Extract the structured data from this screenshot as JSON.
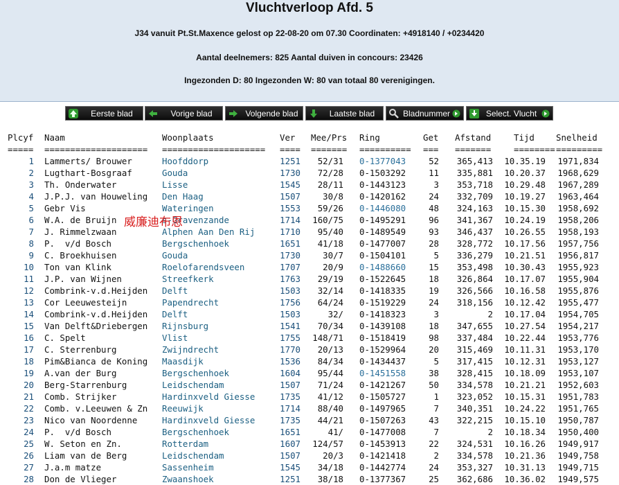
{
  "header": {
    "title": "Vluchtverloop Afd. 5",
    "line1": "J34 vanuit Pt.St.Maxence gelost op 22-08-20 om 07.30 Coordinaten: +4918140 / +0234420",
    "line2": "Aantal deelnemers: 825 Aantal duiven in concours: 23426",
    "line3": "Ingezonden D: 80 Ingezonden W: 80 van totaal 80 verenigingen."
  },
  "nav": {
    "first": "Eerste blad",
    "prev": "Vorige blad",
    "next": "Volgende blad",
    "last": "Laatste blad",
    "page": "Bladnummer",
    "select": "Select. Vlucht"
  },
  "columns": {
    "plcyf": "Plcyf",
    "naam": "Naam",
    "woonplaats": "Woonplaats",
    "ver": "Ver",
    "meeprs": "Mee/Prs",
    "ring": "Ring",
    "get": "Get",
    "afstand": "Afstand",
    "tijd": "Tijd",
    "snelheid": "Snelheid"
  },
  "underline": {
    "plcyf": "=====",
    "naam": "====================",
    "woonplaats": "====================",
    "ver": "====",
    "meeprs": "=======",
    "ring": "==========",
    "get": "===",
    "afstand": "=======",
    "tijd": "========",
    "snelheid": "========="
  },
  "rows": [
    {
      "p": "1",
      "n": "Lammerts/ Brouwer",
      "w": "Hoofddorp",
      "v": "1251",
      "m": "52/31",
      "r": "0-1377043",
      "g": "52",
      "a": "365,413",
      "t": "10.35.19",
      "s": "1971,834"
    },
    {
      "p": "2",
      "n": "Lugthart-Bosgraaf",
      "w": "Gouda",
      "v": "1730",
      "m": "72/28",
      "r": "0-1503292",
      "g": "11",
      "a": "335,881",
      "t": "10.20.37",
      "s": "1968,629"
    },
    {
      "p": "3",
      "n": "Th. Onderwater",
      "w": "Lisse",
      "v": "1545",
      "m": "28/11",
      "r": "0-1443123",
      "g": "3",
      "a": "353,718",
      "t": "10.29.48",
      "s": "1967,289"
    },
    {
      "p": "4",
      "n": "J.P.J. van Houweling",
      "w": "Den Haag",
      "v": "1507",
      "m": "30/8",
      "r": "0-1420162",
      "g": "24",
      "a": "332,709",
      "t": "10.19.27",
      "s": "1963,464"
    },
    {
      "p": "5",
      "n": "Gebr Vis",
      "w": "Wateringen",
      "v": "1553",
      "m": "59/26",
      "r": "0-1446080",
      "g": "48",
      "a": "324,163",
      "t": "10.15.30",
      "s": "1958,692"
    },
    {
      "p": "6",
      "n": "W.A. de Bruijn",
      "w": "s-Gravenzande",
      "v": "1714",
      "m": "160/75",
      "r": "0-1495291",
      "g": "96",
      "a": "341,367",
      "t": "10.24.19",
      "s": "1958,206"
    },
    {
      "p": "7",
      "n": "J. Rimmelzwaan",
      "w": "Alphen Aan Den Rij",
      "v": "1710",
      "m": "95/40",
      "r": "0-1489549",
      "g": "93",
      "a": "346,437",
      "t": "10.26.55",
      "s": "1958,193"
    },
    {
      "p": "8",
      "n": "P.  v/d Bosch",
      "w": "Bergschenhoek",
      "v": "1651",
      "m": "41/18",
      "r": "0-1477007",
      "g": "28",
      "a": "328,772",
      "t": "10.17.56",
      "s": "1957,756"
    },
    {
      "p": "9",
      "n": "C. Broekhuisen",
      "w": "Gouda",
      "v": "1730",
      "m": "30/7",
      "r": "0-1504101",
      "g": "5",
      "a": "336,279",
      "t": "10.21.51",
      "s": "1956,817"
    },
    {
      "p": "10",
      "n": "Ton van Klink",
      "w": "Roelofarendsveen",
      "v": "1707",
      "m": "20/9",
      "r": "0-1488660",
      "g": "15",
      "a": "353,498",
      "t": "10.30.43",
      "s": "1955,923"
    },
    {
      "p": "11",
      "n": "J.P. van Wijnen",
      "w": "Streefkerk",
      "v": "1763",
      "m": "29/19",
      "r": "0-1522645",
      "g": "18",
      "a": "326,864",
      "t": "10.17.07",
      "s": "1955,904"
    },
    {
      "p": "12",
      "n": "Combrink-v.d.Heijden",
      "w": "Delft",
      "v": "1503",
      "m": "32/14",
      "r": "0-1418335",
      "g": "19",
      "a": "326,566",
      "t": "10.16.58",
      "s": "1955,876"
    },
    {
      "p": "13",
      "n": "Cor Leeuwesteijn",
      "w": "Papendrecht",
      "v": "1756",
      "m": "64/24",
      "r": "0-1519229",
      "g": "24",
      "a": "318,156",
      "t": "10.12.42",
      "s": "1955,477"
    },
    {
      "p": "14",
      "n": "Combrink-v.d.Heijden",
      "w": "Delft",
      "v": "1503",
      "m": "32/",
      "r": "0-1418323",
      "g": "3",
      "a": "2",
      "t": "10.17.04",
      "s": "1954,705"
    },
    {
      "p": "15",
      "n": "Van Delft&Driebergen",
      "w": "Rijnsburg",
      "v": "1541",
      "m": "70/34",
      "r": "0-1439108",
      "g": "18",
      "a": "347,655",
      "t": "10.27.54",
      "s": "1954,217"
    },
    {
      "p": "16",
      "n": "C. Spelt",
      "w": "Vlist",
      "v": "1755",
      "m": "148/71",
      "r": "0-1518419",
      "g": "98",
      "a": "337,484",
      "t": "10.22.44",
      "s": "1953,776"
    },
    {
      "p": "17",
      "n": "C. Sterrenburg",
      "w": "Zwijndrecht",
      "v": "1770",
      "m": "20/13",
      "r": "0-1529964",
      "g": "20",
      "a": "315,469",
      "t": "10.11.31",
      "s": "1953,170"
    },
    {
      "p": "18",
      "n": "Pim&Bianca de Koning",
      "w": "Maasdijk",
      "v": "1536",
      "m": "84/34",
      "r": "0-1434437",
      "g": "5",
      "a": "317,415",
      "t": "10.12.31",
      "s": "1953,127"
    },
    {
      "p": "19",
      "n": "A.van der Burg",
      "w": "Bergschenhoek",
      "v": "1604",
      "m": "95/44",
      "r": "0-1451558",
      "g": "38",
      "a": "328,415",
      "t": "10.18.09",
      "s": "1953,107"
    },
    {
      "p": "20",
      "n": "Berg-Starrenburg",
      "w": "Leidschendam",
      "v": "1507",
      "m": "71/24",
      "r": "0-1421267",
      "g": "50",
      "a": "334,578",
      "t": "10.21.21",
      "s": "1952,603"
    },
    {
      "p": "21",
      "n": "Comb. Strijker",
      "w": "Hardinxveld Giesse",
      "v": "1735",
      "m": "41/12",
      "r": "0-1505727",
      "g": "1",
      "a": "323,052",
      "t": "10.15.31",
      "s": "1951,783"
    },
    {
      "p": "22",
      "n": "Comb. v.Leeuwen & Zn",
      "w": "Reeuwijk",
      "v": "1714",
      "m": "88/40",
      "r": "0-1497965",
      "g": "7",
      "a": "340,351",
      "t": "10.24.22",
      "s": "1951,765"
    },
    {
      "p": "23",
      "n": "Nico van Noordenne",
      "w": "Hardinxveld Giesse",
      "v": "1735",
      "m": "44/21",
      "r": "0-1507263",
      "g": "43",
      "a": "322,215",
      "t": "10.15.10",
      "s": "1950,787"
    },
    {
      "p": "24",
      "n": "P.  v/d Bosch",
      "w": "Bergschenhoek",
      "v": "1651",
      "m": "41/",
      "r": "0-1477008",
      "g": "7",
      "a": "2",
      "t": "10.18.34",
      "s": "1950,400"
    },
    {
      "p": "25",
      "n": "W. Seton en Zn.",
      "w": "Rotterdam",
      "v": "1607",
      "m": "124/57",
      "r": "0-1453913",
      "g": "22",
      "a": "324,531",
      "t": "10.16.26",
      "s": "1949,917"
    },
    {
      "p": "26",
      "n": "Liam van de Berg",
      "w": "Leidschendam",
      "v": "1507",
      "m": "20/3",
      "r": "0-1421418",
      "g": "2",
      "a": "334,578",
      "t": "10.21.36",
      "s": "1949,758"
    },
    {
      "p": "27",
      "n": "J.a.m matze",
      "w": "Sassenheim",
      "v": "1545",
      "m": "34/18",
      "r": "0-1442774",
      "g": "24",
      "a": "353,327",
      "t": "10.31.13",
      "s": "1949,715"
    },
    {
      "p": "28",
      "n": "Don de Vlieger",
      "w": "Zwaanshoek",
      "v": "1251",
      "m": "38/18",
      "r": "0-1377367",
      "g": "25",
      "a": "362,686",
      "t": "10.36.02",
      "s": "1949,575"
    }
  ],
  "watermark": "威廉迪布恩"
}
